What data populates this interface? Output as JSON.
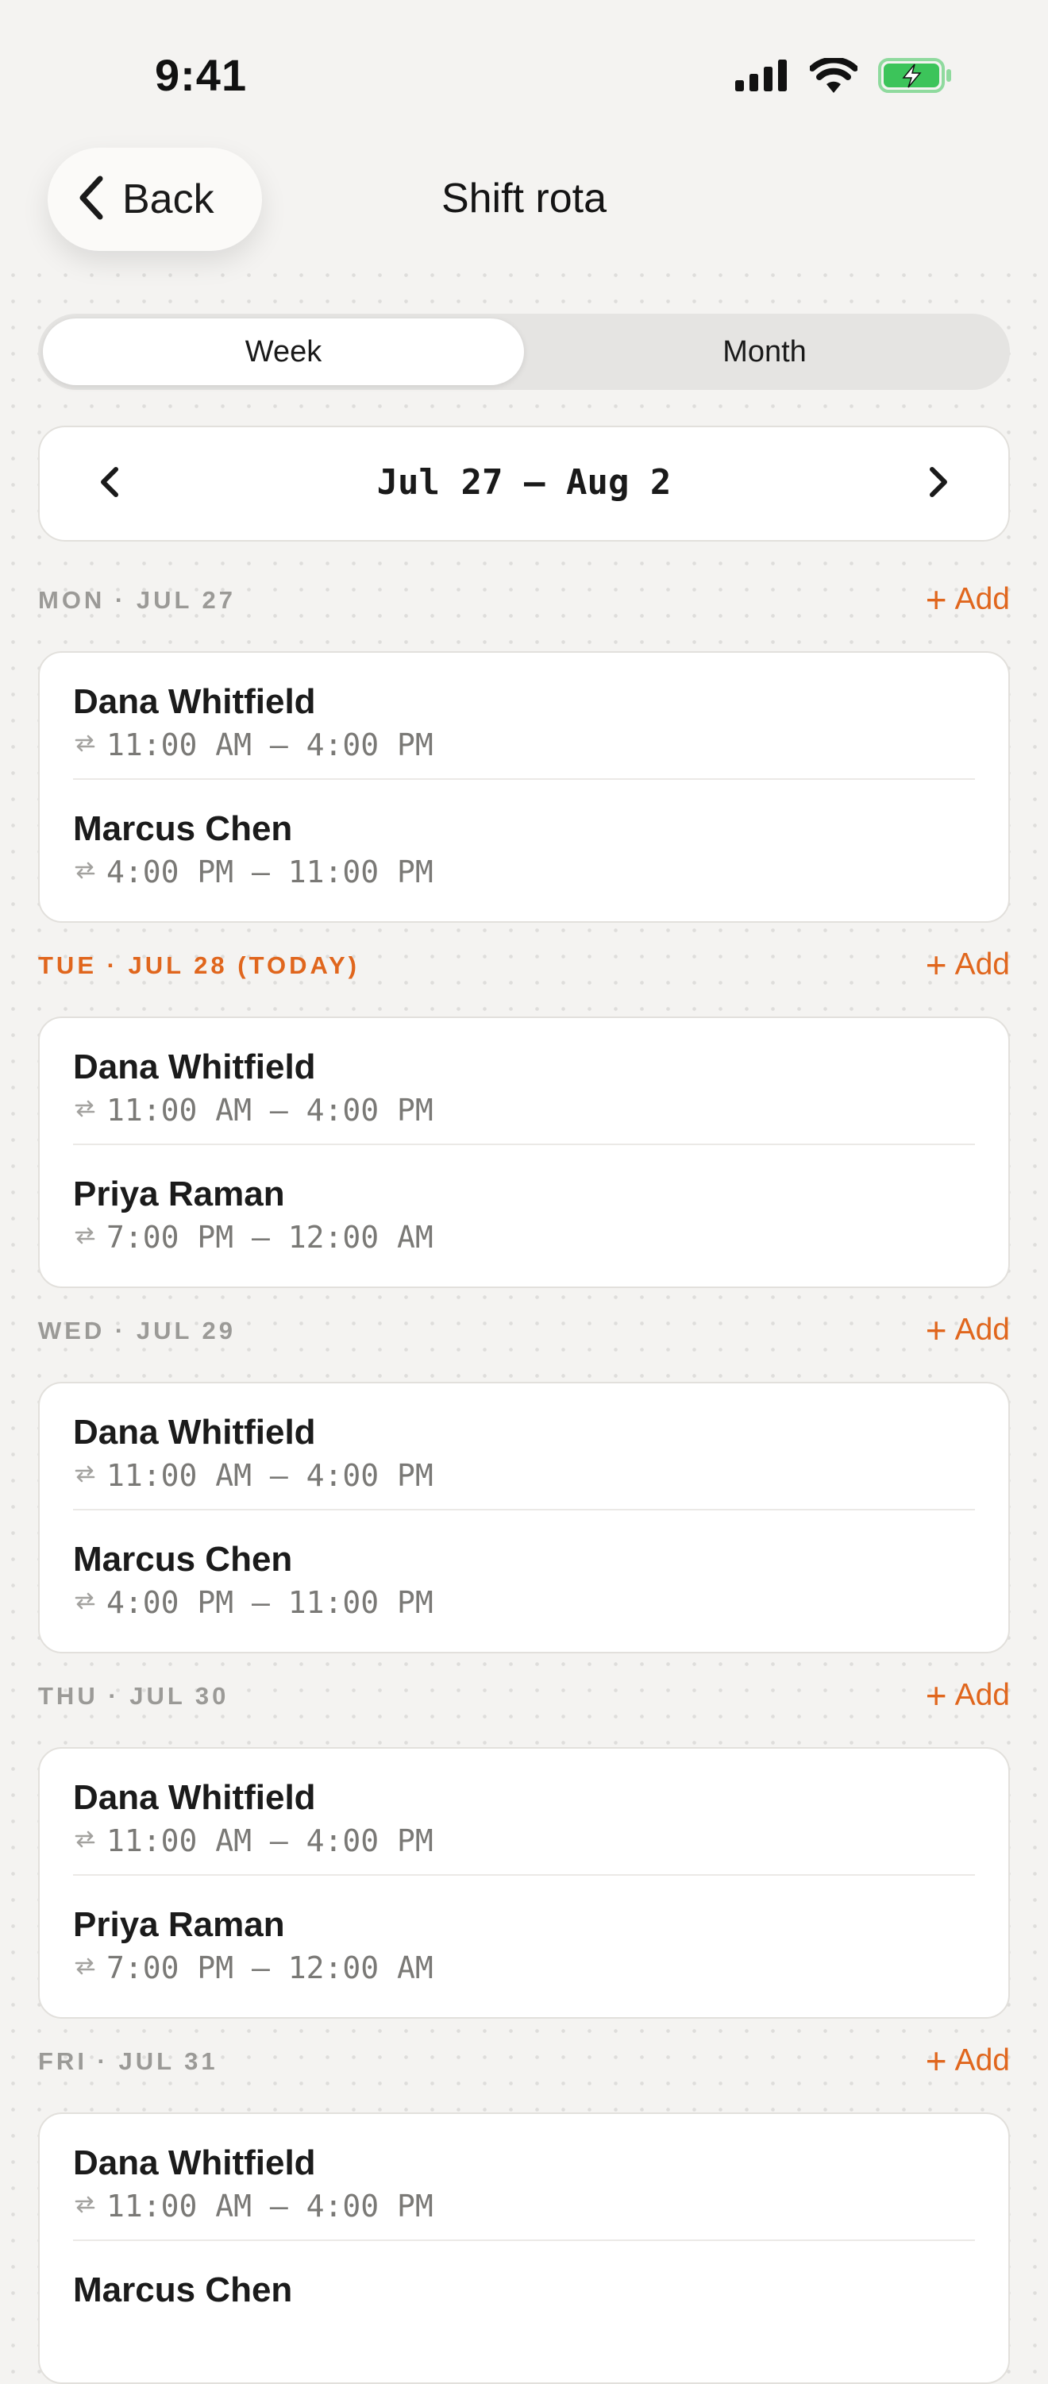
{
  "status_bar": {
    "time": "9:41"
  },
  "header": {
    "back_label": "Back",
    "title": "Shift rota"
  },
  "view_toggle": {
    "options": [
      "Week",
      "Month"
    ],
    "selected": "Week"
  },
  "date_nav": {
    "range": "Jul 27 – Aug 2"
  },
  "colors": {
    "accent": "#e0661d",
    "background": "#f4f3f1",
    "card": "#ffffff",
    "muted_text": "#9b9a97",
    "battery": "#3cc45a"
  },
  "add_label": "Add",
  "days": [
    {
      "label": "MON · JUL 27",
      "today": false,
      "shifts": [
        {
          "name": "Dana Whitfield",
          "time": "11:00 AM – 4:00 PM"
        },
        {
          "name": "Marcus Chen",
          "time": "4:00 PM – 11:00 PM"
        }
      ]
    },
    {
      "label": "TUE · JUL 28  (TODAY)",
      "today": true,
      "shifts": [
        {
          "name": "Dana Whitfield",
          "time": "11:00 AM – 4:00 PM"
        },
        {
          "name": "Priya Raman",
          "time": "7:00 PM – 12:00 AM"
        }
      ]
    },
    {
      "label": "WED · JUL 29",
      "today": false,
      "shifts": [
        {
          "name": "Dana Whitfield",
          "time": "11:00 AM – 4:00 PM"
        },
        {
          "name": "Marcus Chen",
          "time": "4:00 PM – 11:00 PM"
        }
      ]
    },
    {
      "label": "THU · JUL 30",
      "today": false,
      "shifts": [
        {
          "name": "Dana Whitfield",
          "time": "11:00 AM – 4:00 PM"
        },
        {
          "name": "Priya Raman",
          "time": "7:00 PM – 12:00 AM"
        }
      ]
    },
    {
      "label": "FRI · JUL 31",
      "today": false,
      "shifts": [
        {
          "name": "Dana Whitfield",
          "time": "11:00 AM – 4:00 PM"
        },
        {
          "name": "Marcus Chen",
          "time": ""
        }
      ]
    }
  ]
}
